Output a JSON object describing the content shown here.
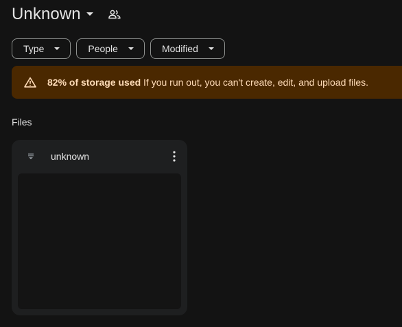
{
  "header": {
    "title": "Unknown",
    "title_caret_icon": "caret-down-icon",
    "share_icon": "people-icon"
  },
  "filters": [
    {
      "label": "Type",
      "icon": "caret-down-icon"
    },
    {
      "label": "People",
      "icon": "caret-down-icon"
    },
    {
      "label": "Modified",
      "icon": "caret-down-icon"
    }
  ],
  "banner": {
    "icon": "warning-icon",
    "bold_text": "82% of storage used",
    "text": "If you run out, you can't create, edit, and upload files.",
    "color": "#4a2800",
    "text_color": "#ffdcb8"
  },
  "section": {
    "title": "Files"
  },
  "files": [
    {
      "name": "unknown",
      "icon": "doc-lines-icon",
      "menu_icon": "more-vert-icon"
    }
  ]
}
